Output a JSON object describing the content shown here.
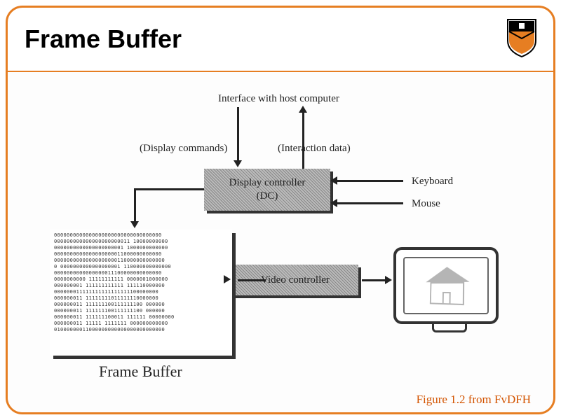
{
  "title": "Frame Buffer",
  "labels": {
    "host": "Interface with host computer",
    "display_commands": "(Display commands)",
    "interaction_data": "(Interaction data)",
    "keyboard": "Keyboard",
    "mouse": "Mouse",
    "frame_buffer": "Frame Buffer"
  },
  "blocks": {
    "display_controller": "Display controller\n(DC)",
    "video_controller": "Video controller"
  },
  "figure_caption": "Figure 1.2 from FvDFH",
  "fb_rows": [
    "0000000000000000000000000000000000",
    "000000000000000000000011 10000000000",
    "0000000000000000000001 1000000000000",
    "0000000000000000000011000000000000",
    "00000000000000000000110000000000000",
    "0 0000000000000000001 110000000000000",
    "0000000000000000011100000000000000",
    "0000000000 11111111111 0000001000000",
    "000000001 111111111111 111110000000",
    "000000011111111111111111100000000",
    "000000011 11111111011111110000000",
    "000000011 111111100111111100 000000",
    "000000011 111111100111111100 000000",
    "000000011 111111100011 111111 00000000",
    "000000011 11111 1111111 000000000000",
    "01000000011000000000000000000000000"
  ]
}
